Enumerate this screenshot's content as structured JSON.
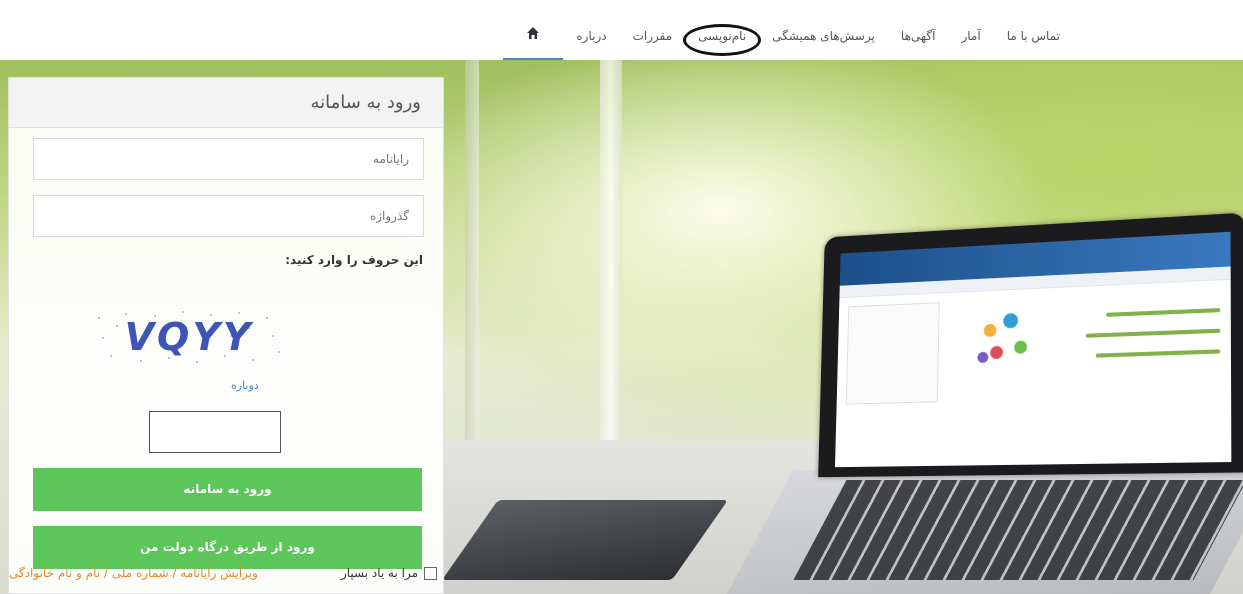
{
  "nav": {
    "home_icon": "home-icon",
    "items": [
      {
        "label": "درباره"
      },
      {
        "label": "مقررات"
      },
      {
        "label": "نام‌نویسی"
      },
      {
        "label": "پرسش‌های همیشگی"
      },
      {
        "label": "آگهی‌ها"
      },
      {
        "label": "آمار"
      },
      {
        "label": "تماس با ما"
      }
    ]
  },
  "login": {
    "title": "ورود به سامانه",
    "email_placeholder": "رایانامه",
    "password_placeholder": "گذرواژه",
    "captcha_label": "این حروف را وارد کنید:",
    "captcha_text": "VQYY",
    "refresh_label": "دوباره",
    "submit_label": "ورود به سامانه",
    "gov_login_label": "ورود از طریق درگاه دولت من",
    "remember_label": "مرا به یاد بسپار",
    "edit_link_label": "ویرایش رایانامه / شماره ملی / نام و نام خانوادگی"
  },
  "colors": {
    "accent_green": "#5cc65b",
    "nav_active": "#4a86c5",
    "edit_link": "#e08a2b"
  }
}
